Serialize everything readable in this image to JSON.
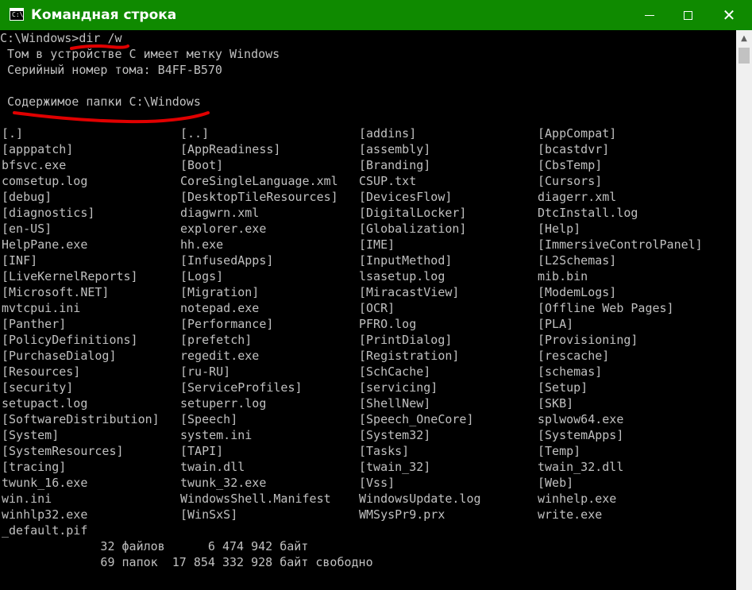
{
  "window": {
    "title": "Командная строка",
    "icon": "cmd-icon",
    "icon_prompt": "C:\\",
    "buttons": {
      "minimize_icon": "minimize-icon",
      "maximize_icon": "maximize-icon",
      "close_icon": "close-icon",
      "close_glyph": "✕"
    },
    "titlebar_color": "#0f8a00"
  },
  "console": {
    "text_color": "#c0c0c0",
    "background": "#000000",
    "command_line": "C:\\Windows>dir /w",
    "volume_label": " Том в устройстве C имеет метку Windows",
    "serial": " Серийный номер тома: B4FF-B570",
    "folder_header": " Содержимое папки C:\\Windows",
    "listing": [
      [
        "[.]",
        "[..]",
        "[addins]",
        "[AppCompat]"
      ],
      [
        "[apppatch]",
        "[AppReadiness]",
        "[assembly]",
        "[bcastdvr]"
      ],
      [
        "bfsvc.exe",
        "[Boot]",
        "[Branding]",
        "[CbsTemp]"
      ],
      [
        "comsetup.log",
        "CoreSingleLanguage.xml",
        "CSUP.txt",
        "[Cursors]"
      ],
      [
        "[debug]",
        "[DesktopTileResources]",
        "[DevicesFlow]",
        "diagerr.xml"
      ],
      [
        "[diagnostics]",
        "diagwrn.xml",
        "[DigitalLocker]",
        "DtcInstall.log"
      ],
      [
        "[en-US]",
        "explorer.exe",
        "[Globalization]",
        "[Help]"
      ],
      [
        "HelpPane.exe",
        "hh.exe",
        "[IME]",
        "[ImmersiveControlPanel]"
      ],
      [
        "[INF]",
        "[InfusedApps]",
        "[InputMethod]",
        "[L2Schemas]"
      ],
      [
        "[LiveKernelReports]",
        "[Logs]",
        "lsasetup.log",
        "mib.bin"
      ],
      [
        "[Microsoft.NET]",
        "[Migration]",
        "[MiracastView]",
        "[ModemLogs]"
      ],
      [
        "mvtcpui.ini",
        "notepad.exe",
        "[OCR]",
        "[Offline Web Pages]"
      ],
      [
        "[Panther]",
        "[Performance]",
        "PFRO.log",
        "[PLA]"
      ],
      [
        "[PolicyDefinitions]",
        "[prefetch]",
        "[PrintDialog]",
        "[Provisioning]"
      ],
      [
        "[PurchaseDialog]",
        "regedit.exe",
        "[Registration]",
        "[rescache]"
      ],
      [
        "[Resources]",
        "[ru-RU]",
        "[SchCache]",
        "[schemas]"
      ],
      [
        "[security]",
        "[ServiceProfiles]",
        "[servicing]",
        "[Setup]"
      ],
      [
        "setupact.log",
        "setuperr.log",
        "[ShellNew]",
        "[SKB]"
      ],
      [
        "[SoftwareDistribution]",
        "[Speech]",
        "[Speech_OneCore]",
        "splwow64.exe"
      ],
      [
        "[System]",
        "system.ini",
        "[System32]",
        "[SystemApps]"
      ],
      [
        "[SystemResources]",
        "[TAPI]",
        "[Tasks]",
        "[Temp]"
      ],
      [
        "[tracing]",
        "twain.dll",
        "[twain_32]",
        "twain_32.dll"
      ],
      [
        "twunk_16.exe",
        "twunk_32.exe",
        "[Vss]",
        "[Web]"
      ],
      [
        "win.ini",
        "WindowsShell.Manifest",
        "WindowsUpdate.log",
        "winhelp.exe"
      ],
      [
        "winhlp32.exe",
        "[WinSxS]",
        "WMSysPr9.prx",
        "write.exe"
      ],
      [
        "_default.pif",
        "",
        "",
        ""
      ]
    ],
    "summary_files": "              32 файлов      6 474 942 байт",
    "summary_dirs": "              69 папок  17 854 332 928 байт свободно"
  },
  "annotations": {
    "underline_color": "#e00000"
  },
  "scrollbar": {
    "up_arrow_glyph": "▲"
  }
}
